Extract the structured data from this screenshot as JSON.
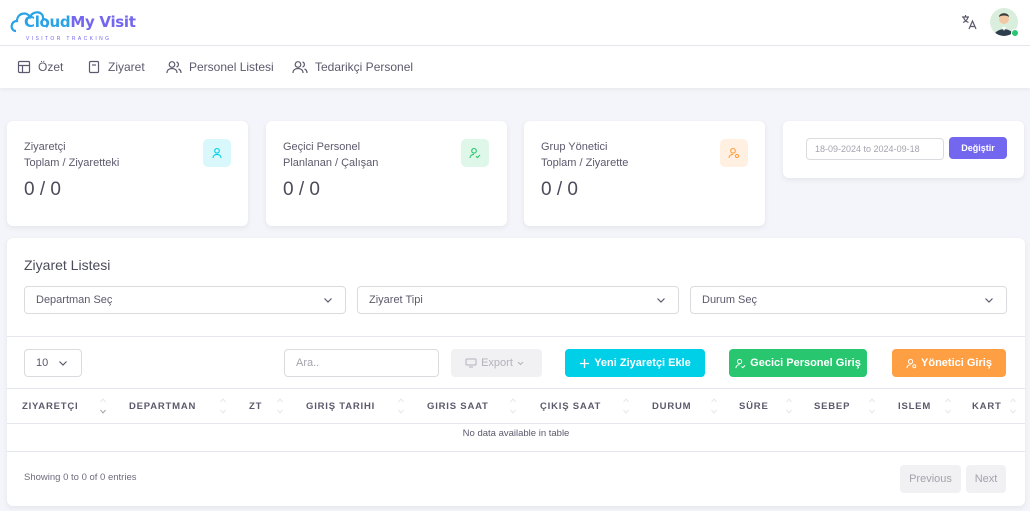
{
  "app": {
    "logo_main_1": "Cloud",
    "logo_main_2": "My Visit",
    "logo_sub": "VISITOR TRACKING"
  },
  "nav": {
    "items": [
      {
        "label": "Özet",
        "icon": "layout-icon"
      },
      {
        "label": "Ziyaret",
        "icon": "door-icon"
      },
      {
        "label": "Personel Listesi",
        "icon": "users-icon"
      },
      {
        "label": "Tedarikçi Personel",
        "icon": "users-icon"
      }
    ]
  },
  "stats": [
    {
      "title_1": "Ziyaretçi",
      "title_2": "Toplam / Ziyaretteki",
      "value": "0 / 0",
      "icon": "user-icon",
      "color": "#00cfe8"
    },
    {
      "title_1": "Geçici Personel",
      "title_2": "Planlanan / Çalışan",
      "value": "0 / 0",
      "icon": "user-check-icon",
      "color": "#28c76f"
    },
    {
      "title_1": "Grup Yönetici",
      "title_2": "Toplam / Ziyarette",
      "value": "0 / 0",
      "icon": "user-cog-icon",
      "color": "#ff9f43"
    }
  ],
  "date_filter": {
    "value": "18-09-2024 to 2024-09-18",
    "button": "Değiştir"
  },
  "list": {
    "title": "Ziyaret Listesi",
    "filters": [
      "Departman Seç",
      "Ziyaret Tipi",
      "Durum Seç"
    ],
    "page_length": "10",
    "search_placeholder": "Ara..",
    "export": "Export",
    "add_visitor": "Yeni Ziyaretçi Ekle",
    "temp_staff_entry": "Gecici Personel Giriş",
    "manager_entry": "Yönetici Giriş",
    "columns": [
      "ZIYARETÇI",
      "DEPARTMAN",
      "ZT",
      "GIRIŞ TARIHI",
      "GIRIS SAAT",
      "ÇIKIŞ SAAT",
      "DURUM",
      "SÜRE",
      "SEBEP",
      "ISLEM",
      "KART"
    ],
    "empty_text": "No data available in table",
    "info": "Showing 0 to 0 of 0 entries",
    "prev": "Previous",
    "next": "Next"
  },
  "colors": {
    "primary": "#7367f0",
    "info": "#00cfe8",
    "success": "#28c76f",
    "warning": "#ff9f43"
  }
}
